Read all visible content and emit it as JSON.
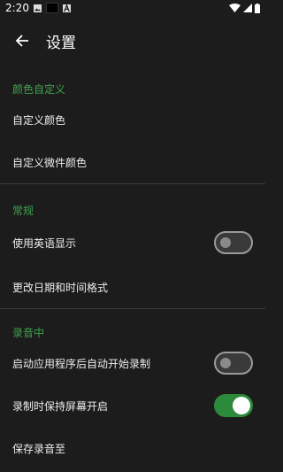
{
  "status_bar": {
    "time": "2:20"
  },
  "toolbar": {
    "title": "设置"
  },
  "sections": {
    "color": {
      "header": "颜色自定义",
      "custom_color": "自定义颜色",
      "custom_widget_color": "自定义微件颜色"
    },
    "general": {
      "header": "常规",
      "use_english": "使用英语显示",
      "use_english_on": false,
      "change_date_format": "更改日期和时间格式"
    },
    "recording": {
      "header": "录音中",
      "auto_start": "启动应用程序后自动开始录制",
      "auto_start_on": false,
      "keep_screen_on": "录制时保持屏幕开启",
      "keep_screen_on_on": true,
      "save_to": "保存录音至"
    }
  },
  "colors": {
    "accent": "#3fa34d",
    "background": "#1c1c1c",
    "switch_on": "#2c8a3b"
  }
}
